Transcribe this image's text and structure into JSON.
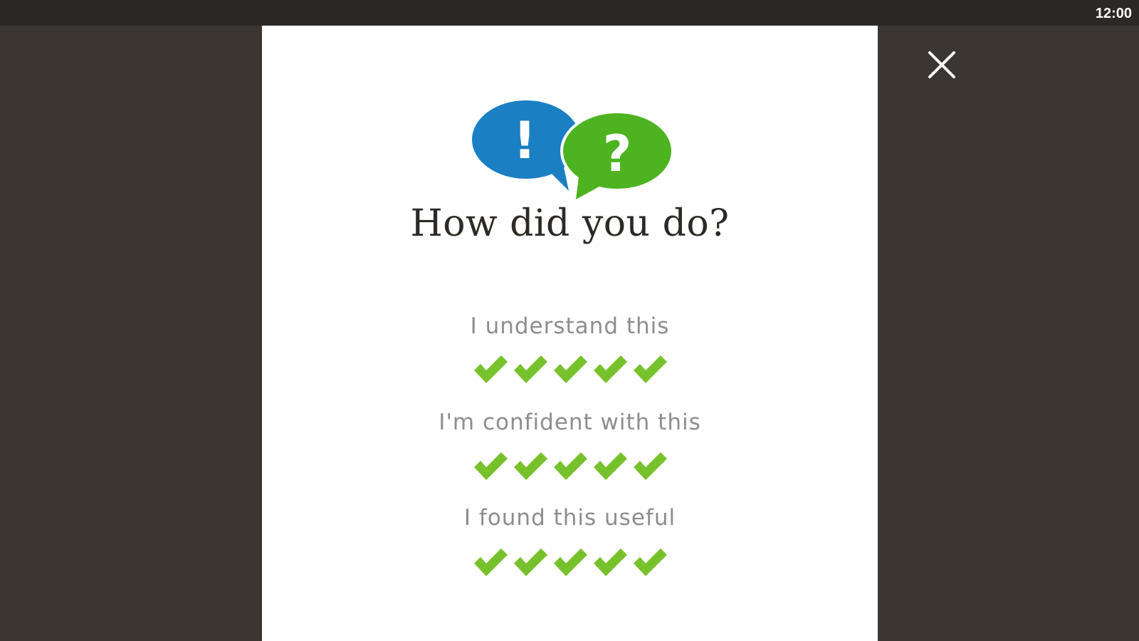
{
  "status_bar": {
    "time": "12:00"
  },
  "dialog": {
    "logo": {
      "left_symbol": "!",
      "right_symbol": "?"
    },
    "title": "How did you do?",
    "ratings": [
      {
        "label": "I understand this",
        "score": 5,
        "max": 5
      },
      {
        "label": "I'm confident with this",
        "score": 5,
        "max": 5
      },
      {
        "label": "I found this useful",
        "score": 5,
        "max": 5
      }
    ]
  },
  "colors": {
    "background": "#3b3632",
    "status_bar": "#2b2825",
    "dialog": "#ffffff",
    "blue_bubble": "#1b7fc4",
    "green_bubble": "#4db320",
    "check": "#77c22c",
    "label_text": "#8d8d8d",
    "title_text": "#2d2a26"
  },
  "icons": {
    "close": "close-icon",
    "logo": "speech-bubbles-icon",
    "check": "checkmark-icon"
  }
}
